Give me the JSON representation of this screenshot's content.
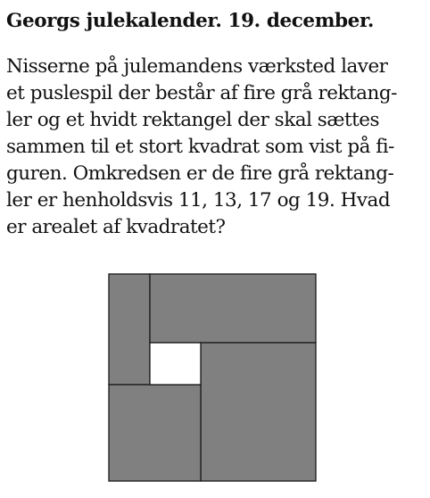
{
  "document": {
    "title": "Georgs julekalender. 19. december.",
    "body_lines": [
      "Nisserne på julemandens værksted laver",
      "et puslespil der består af fire grå rektang-",
      "ler og et hvidt rektangel der skal sættes",
      "sammen til et stort kvadrat som vist på fi-",
      "guren. Omkredsen er de fire grå rektang-",
      "ler er henholdsvis 11, 13, 17 og 19. Hvad",
      "er arealet af kvadratet?"
    ]
  },
  "figure": {
    "gray_color": "#808080",
    "white_color": "#ffffff",
    "stroke_color": "#1a1a1a"
  }
}
